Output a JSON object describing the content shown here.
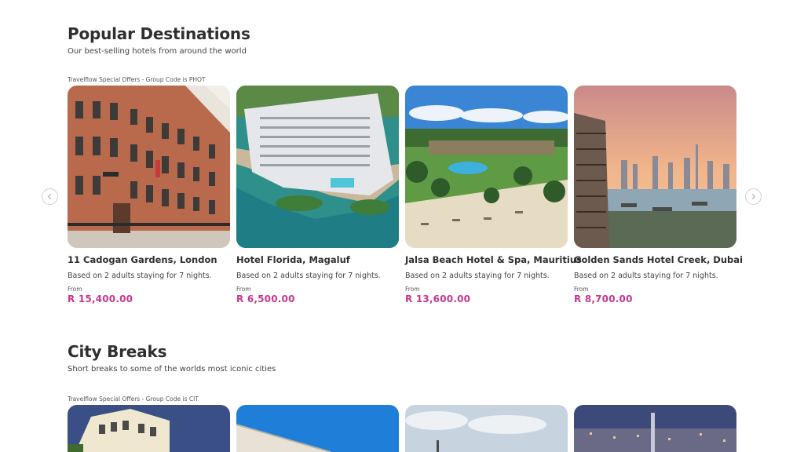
{
  "popular": {
    "title": "Popular Destinations",
    "subtitle": "Our best-selling hotels from around the world",
    "offer_note": "Travelflow Special Offers - Group Code is PHOT",
    "cards": [
      {
        "name": "11 Cadogan Gardens, London",
        "stay": "Based on 2 adults staying for 7 nights.",
        "from": "From",
        "price": "R 15,400.00"
      },
      {
        "name": "Hotel Florida, Magaluf",
        "stay": "Based on 2 adults staying for 7 nights.",
        "from": "From",
        "price": "R 6,500.00"
      },
      {
        "name": "Jalsa Beach Hotel & Spa, Mauritius",
        "stay": "Based on 2 adults staying for 7 nights.",
        "from": "From",
        "price": "R 13,600.00"
      },
      {
        "name": "Golden Sands Hotel Creek, Dubai",
        "stay": "Based on 2 adults staying for 7 nights.",
        "from": "From",
        "price": "R 8,700.00"
      }
    ]
  },
  "city": {
    "title": "City Breaks",
    "subtitle": "Short breaks to some of the worlds most iconic cities",
    "offer_note": "Travelflow Special Offers - Group Code is CIT"
  },
  "nav": {
    "prev_icon": "chevron-left-icon",
    "next_icon": "chevron-right-icon"
  },
  "colors": {
    "price": "#c8378f",
    "heading": "#2f2f2f"
  }
}
